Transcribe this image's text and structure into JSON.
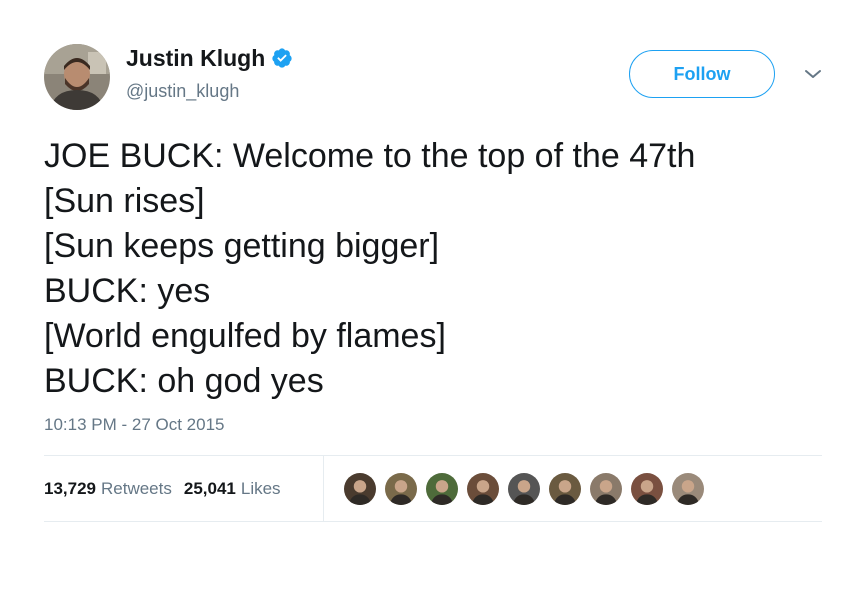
{
  "author": {
    "display_name": "Justin Klugh",
    "handle": "@justin_klugh",
    "verified": true,
    "avatar": "profile-photo"
  },
  "follow_button": {
    "label": "Follow"
  },
  "menu": {
    "icon": "chevron-down-icon"
  },
  "tweet": {
    "lines": [
      "JOE BUCK: Welcome to the top of the 47th",
      "[Sun rises]",
      "[Sun keeps getting bigger]",
      "BUCK: yes",
      "[World engulfed by flames]",
      "BUCK: oh god yes"
    ],
    "timestamp": "10:13 PM - 27 Oct 2015"
  },
  "stats": {
    "retweets_count": "13,729",
    "retweets_label": "Retweets",
    "likes_count": "25,041",
    "likes_label": "Likes"
  },
  "likers": [
    {
      "icon": "liker-avatar-icon",
      "bg": "#4a3b2e"
    },
    {
      "icon": "liker-avatar-icon",
      "bg": "#7a6a4a"
    },
    {
      "icon": "liker-avatar-icon",
      "bg": "#4e6b3a"
    },
    {
      "icon": "liker-avatar-icon",
      "bg": "#6b4d3a"
    },
    {
      "icon": "liker-avatar-icon",
      "bg": "#555555"
    },
    {
      "icon": "liker-avatar-icon",
      "bg": "#6a5a40"
    },
    {
      "icon": "liker-avatar-icon",
      "bg": "#8a7a6a"
    },
    {
      "icon": "liker-avatar-icon",
      "bg": "#7a5040"
    },
    {
      "icon": "liker-avatar-icon",
      "bg": "#9a8a7a"
    }
  ],
  "colors": {
    "accent": "#1da1f2",
    "text": "#14171a",
    "secondary_text": "#657786",
    "divider": "#e6ecf0"
  }
}
